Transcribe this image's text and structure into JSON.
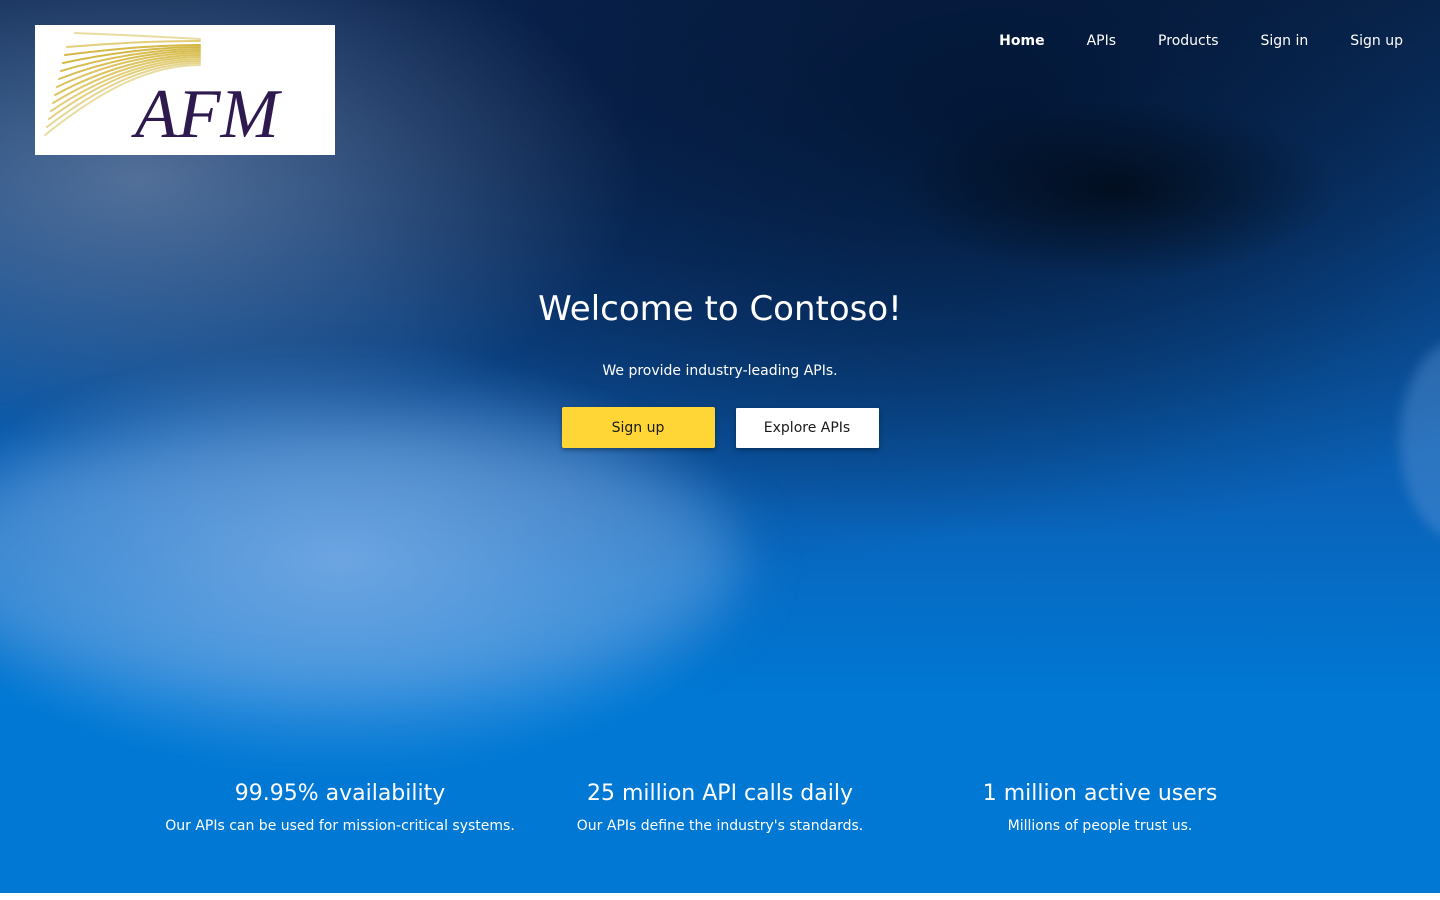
{
  "logo": {
    "text": "AFM",
    "icon": "afm-logo"
  },
  "nav": {
    "items": [
      {
        "label": "Home",
        "active": true
      },
      {
        "label": "APIs",
        "active": false
      },
      {
        "label": "Products",
        "active": false
      },
      {
        "label": "Sign in",
        "active": false
      },
      {
        "label": "Sign up",
        "active": false
      }
    ]
  },
  "hero": {
    "title": "Welcome to Contoso!",
    "subtitle": "We provide industry-leading APIs.",
    "primary_button": "Sign up",
    "secondary_button": "Explore APIs"
  },
  "stats": [
    {
      "title": "99.95% availability",
      "description": "Our APIs can be used for mission-critical systems."
    },
    {
      "title": "25 million API calls daily",
      "description": "Our APIs define the industry's standards."
    },
    {
      "title": "1 million active users",
      "description": "Millions of people trust us."
    }
  ],
  "colors": {
    "brand_blue": "#0078d4",
    "primary_button": "#ffd635",
    "logo_purple": "#2f1a4f",
    "logo_gold": "#e3cf7a"
  }
}
